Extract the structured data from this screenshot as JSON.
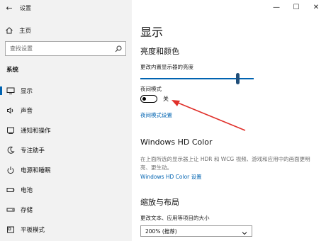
{
  "window": {
    "title": "设置",
    "controls": {
      "minimize": "—",
      "maximize": "☐",
      "close": "✕"
    }
  },
  "sidebar": {
    "back_icon": "back-arrow-icon",
    "home_label": "主页",
    "search_placeholder": "查找设置",
    "section_title": "系统",
    "items": [
      {
        "label": "显示",
        "icon": "monitor-icon",
        "active": true
      },
      {
        "label": "声音",
        "icon": "speaker-icon"
      },
      {
        "label": "通知和操作",
        "icon": "notification-icon"
      },
      {
        "label": "专注助手",
        "icon": "moon-icon"
      },
      {
        "label": "电源和睡眠",
        "icon": "power-icon"
      },
      {
        "label": "电池",
        "icon": "battery-icon"
      },
      {
        "label": "存储",
        "icon": "storage-icon"
      },
      {
        "label": "平板模式",
        "icon": "tablet-icon"
      }
    ]
  },
  "main": {
    "page_title": "显示",
    "brightness": {
      "heading": "亮度和颜色",
      "slider_label": "更改内置显示器的亮度",
      "slider_value": 0.86
    },
    "night_light": {
      "label": "夜间模式",
      "state": "关",
      "settings_link": "夜间模式设置"
    },
    "hd_color": {
      "heading": "Windows HD Color",
      "description": "在上面所选的显示器上让 HDR 和 WCG 视频、游戏和应用中的画面更明亮、更生动。",
      "link": "Windows HD Color 设置"
    },
    "scale": {
      "heading": "缩放与布局",
      "label": "更改文本、应用等项目的大小",
      "dropdown_value": "200% (推荐)"
    }
  },
  "annotation": {
    "color": "#e0302a"
  },
  "colors": {
    "accent": "#0063b1",
    "sidebar_bg": "#f2f2f2"
  }
}
